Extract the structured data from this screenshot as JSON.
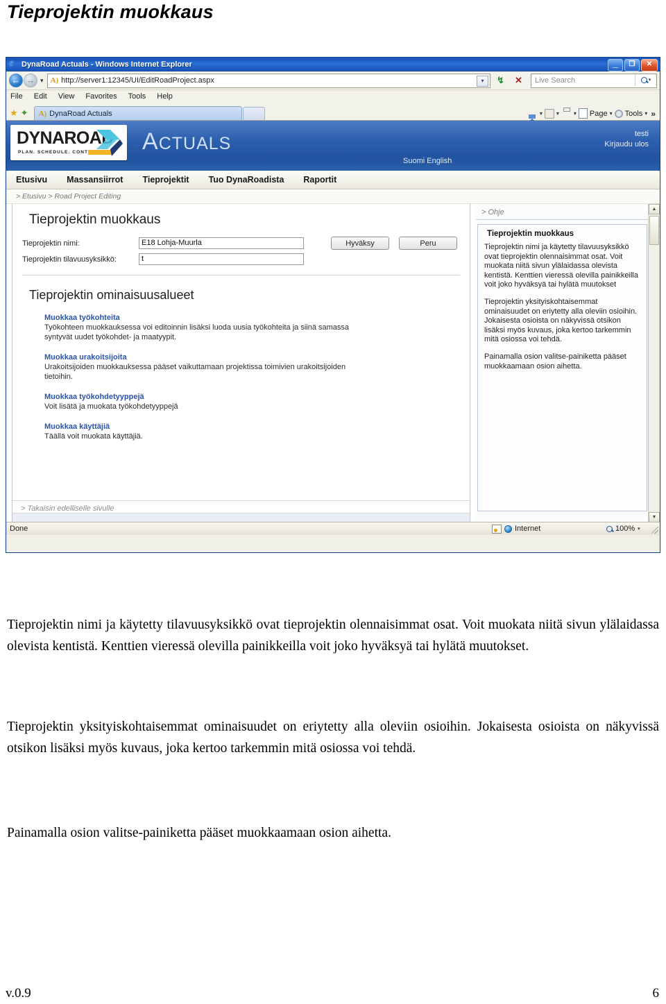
{
  "document": {
    "title": "Tieprojektin muokkaus",
    "paragraphs": [
      "Tieprojektin nimi ja käytetty tilavuusyksikkö ovat tieprojektin olennaisimmat osat. Voit muokata niitä sivun ylälaidassa olevista kentistä. Kenttien vieressä olevilla painikkeilla voit joko hyväksyä tai hylätä muutokset.",
      "Tieprojektin yksityiskohtaisemmat ominaisuudet on eriytetty alla oleviin osioihin. Jokaisesta osioista on näkyvissä otsikon lisäksi myös kuvaus, joka kertoo tarkemmin mitä osiossa voi tehdä.",
      "Painamalla osion valitse-painiketta pääset muokkaamaan osion aihetta."
    ],
    "footer_version": "v.0.9",
    "footer_page": "6"
  },
  "browser": {
    "window_title": "DynaRoad Actuals - Windows Internet Explorer",
    "ie_logo": "ie-logo-icon",
    "window_controls": {
      "minimize": "_",
      "restore": "❐",
      "close": "✕"
    },
    "address": {
      "back_arrow": "←",
      "forward_arrow": "→",
      "history_caret": "▾",
      "url_icon": "A)",
      "url": "http://server1:12345/UI/EditRoadProject.aspx",
      "dropdown_caret": "▾",
      "refresh_glyph": "↯",
      "stop_glyph": "✕",
      "search_placeholder": "Live Search",
      "search_caret": "▾"
    },
    "menu": [
      "File",
      "Edit",
      "View",
      "Favorites",
      "Tools",
      "Help"
    ],
    "tabs": {
      "favorites_star": "★",
      "add_favorite": "✦",
      "tab_icon": "A)",
      "tab_label": "DynaRoad Actuals"
    },
    "command_bar": {
      "home": "Home",
      "feeds": "Feeds",
      "print": "Print",
      "page": "Page",
      "tools": "Tools",
      "overflow": "»",
      "caret": "▾"
    },
    "status": {
      "text": "Done",
      "zone": "Internet",
      "zoom": "100%",
      "zoom_caret": "▾"
    },
    "scrollbar": {
      "up": "▲",
      "down": "▼"
    }
  },
  "app": {
    "logo_word": "DYNAROAD",
    "logo_tagline": "PLAN. SCHEDULE. CONTROL.",
    "title_first": "A",
    "title_rest": "CTUALS",
    "languages": "Suomi English",
    "user": "testi",
    "logout": "Kirjaudu ulos",
    "nav": [
      "Etusivu",
      "Massansiirrot",
      "Tieprojektit",
      "Tuo DynaRoadista",
      "Raportit"
    ],
    "breadcrumb": "> Etusivu  > Road Project Editing"
  },
  "main": {
    "heading": "Tieprojektin muokkaus",
    "fields": [
      {
        "label": "Tieprojektin nimi:",
        "value": "E18 Lohja-Muurla"
      },
      {
        "label": "Tieprojektin tilavuusyksikkö:",
        "value": "t"
      }
    ],
    "buttons": {
      "accept": "Hyväksy",
      "cancel": "Peru"
    },
    "sections_heading": "Tieprojektin ominaisuusalueet",
    "features": [
      {
        "link": "Muokkaa työkohteita",
        "desc": "Työkohteen muokkauksessa voi editoinnin lisäksi luoda uusia työkohteita ja siinä samassa syntyvät uudet työkohdet- ja maatyypit."
      },
      {
        "link": "Muokkaa urakoitsijoita",
        "desc": "Urakoitsijoiden muokkauksessa pääset vaikuttamaan projektissa toimivien urakoitsijoiden tietoihin."
      },
      {
        "link": "Muokkaa työkohdetyyppejä",
        "desc": "Voit lisätä ja muokata työkohdetyyppejä"
      },
      {
        "link": "Muokkaa käyttäjiä",
        "desc": "Täällä voit muokata käyttäjiä."
      }
    ],
    "back_link": "> Takaisin edelliselle sivulle"
  },
  "help": {
    "link": "> Ohje",
    "title": "Tieprojektin muokkaus",
    "paragraphs": [
      "Tieprojektin nimi ja käytetty tilavuusyksikkö ovat tieprojektin olennaisimmat osat. Voit muokata niitä sivun ylälaidassa olevista kentistä. Kenttien vieressä olevilla painikkeilla voit joko hyväksyä tai hylätä muutokset",
      "Tieprojektin yksityiskohtaisemmat ominaisuudet on eriytetty alla oleviin osioihin. Jokaisesta osioista on näkyvissä otsikon lisäksi myös kuvaus, joka kertoo tarkemmin mitä osiossa voi tehdä.",
      "Painamalla osion valitse-painiketta pääset muokkaamaan osion aihetta."
    ]
  },
  "colors": {
    "title_bar": "#1b56b8",
    "app_header": "#2c5fae",
    "link": "#2a54a8",
    "logo_yellow": "#f0b323",
    "logo_cyan": "#4cc3e0",
    "logo_navy": "#1f3b73"
  }
}
